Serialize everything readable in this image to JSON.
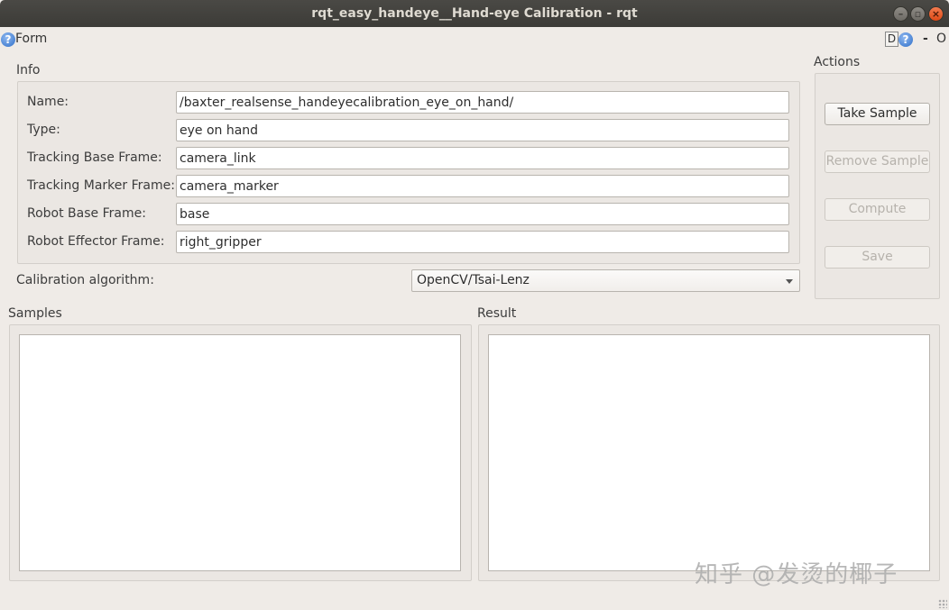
{
  "window": {
    "title": "rqt_easy_handeye__Hand-eye Calibration - rqt"
  },
  "formbar": {
    "label": "Form",
    "d_label": "D",
    "help_glyph": "?",
    "dash_label": "-",
    "float_label": "O"
  },
  "info": {
    "title": "Info",
    "rows": [
      {
        "label": "Name:",
        "value": "/baxter_realsense_handeyecalibration_eye_on_hand/"
      },
      {
        "label": "Type:",
        "value": "eye on hand"
      },
      {
        "label": "Tracking Base Frame:",
        "value": "camera_link"
      },
      {
        "label": "Tracking Marker Frame:",
        "value": "camera_marker"
      },
      {
        "label": "Robot Base Frame:",
        "value": "base"
      },
      {
        "label": "Robot Effector Frame:",
        "value": "right_gripper"
      }
    ]
  },
  "calibration": {
    "label": "Calibration algorithm:",
    "selected": "OpenCV/Tsai-Lenz"
  },
  "actions": {
    "title": "Actions",
    "take_sample": "Take Sample",
    "remove_sample": "Remove Sample",
    "compute": "Compute",
    "save": "Save"
  },
  "samples": {
    "title": "Samples"
  },
  "result": {
    "title": "Result"
  },
  "watermark": "知乎 @发烫的椰子",
  "colors": {
    "titlebar": "#3c3b37",
    "window_bg": "#efebe7",
    "close_button": "#df4a16",
    "help_icon": "#2f6fc8"
  },
  "icons": {
    "help": "question-circle-icon",
    "minimize": "minimize-icon",
    "maximize": "maximize-icon",
    "close": "close-icon",
    "dropdown": "chevron-down-icon"
  }
}
